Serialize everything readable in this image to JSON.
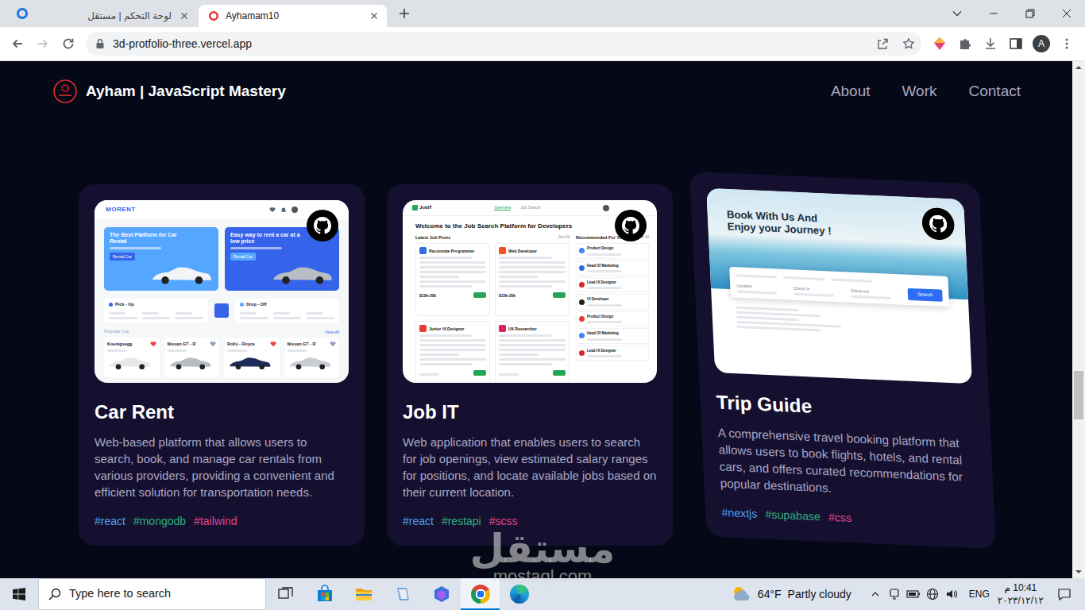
{
  "browser": {
    "tabs": [
      {
        "label": "لوحة التحكم | مستقل",
        "selected": false
      },
      {
        "label": "Ayhamam10",
        "selected": true
      }
    ],
    "back_enabled": true,
    "forward_enabled": false,
    "url": "3d-protfolio-three.vercel.app",
    "profile": "A"
  },
  "site": {
    "brand": "Ayham | JavaScript Mastery",
    "nav": [
      "About",
      "Work",
      "Contact"
    ]
  },
  "projects": [
    {
      "name": "Car Rent",
      "description": "Web-based platform that allows users to search, book, and manage car rentals from various providers, providing a convenient and efficient solution for transportation needs.",
      "tags": [
        {
          "label": "#react",
          "color": "#4a9fe8"
        },
        {
          "label": "#mongodb",
          "color": "#2fae7e"
        },
        {
          "label": "#tailwind",
          "color": "#e0448a"
        }
      ],
      "thumb": {
        "kind": "car",
        "brand": "MORENT",
        "hero": [
          {
            "title": "The Best Platform for Car Rental",
            "button": "Rental Car"
          },
          {
            "title": "Easy way to rent a car at a low price",
            "button": "Rental Car"
          }
        ],
        "pickup": [
          "Pick - Up",
          "Drop - Off"
        ],
        "section": "Popular Car",
        "link": "View All",
        "cars": [
          "Koenigsegg",
          "Nissan GT - R",
          "Rolls - Royce",
          "Nissan GT - R"
        ]
      }
    },
    {
      "name": "Job IT",
      "description": "Web application that enables users to search for job openings, view estimated salary ranges for positions, and locate available jobs based on their current location.",
      "tags": [
        {
          "label": "#react",
          "color": "#4a9fe8"
        },
        {
          "label": "#restapi",
          "color": "#2fae7e"
        },
        {
          "label": "#scss",
          "color": "#e0448a"
        }
      ],
      "thumb": {
        "kind": "job",
        "brand": "JobIT",
        "menu": [
          {
            "label": "Overview",
            "selected": true
          },
          {
            "label": "Job Search",
            "selected": false
          }
        ],
        "heading": "Welcome to the Job Search Platform for Developers",
        "latest": "Latest Job Posts",
        "latest_link": "See All",
        "jobs": [
          {
            "title": "Passionate Programmer",
            "salary": "$15k-20k"
          },
          {
            "title": "Web Developer",
            "salary": "$15k-20k"
          },
          {
            "title": "Junior UI Designer"
          },
          {
            "title": "UX Researcher"
          }
        ],
        "recommended": "Recommended For You",
        "rec_link": "See All",
        "recs": [
          "Product Design",
          "Head Of Marketing",
          "Lead UI Designer",
          "UI Developer",
          "Product Design",
          "Head Of Marketing",
          "Lead UI Designer"
        ]
      }
    },
    {
      "name": "Trip Guide",
      "description": "A comprehensive travel booking platform that allows users to book flights, hotels, and rental cars, and offers curated recommendations for popular destinations.",
      "tags": [
        {
          "label": "#nextjs",
          "color": "#4a9fe8"
        },
        {
          "label": "#supabase",
          "color": "#2fae7e"
        },
        {
          "label": "#css",
          "color": "#e0448a"
        }
      ],
      "thumb": {
        "kind": "trip",
        "heading": "Book With Us And Enjoy your Journey !",
        "fields": [
          "Location",
          "Check In",
          "Check out"
        ],
        "button": "Search"
      }
    }
  ],
  "scroll": {
    "level": 0.67
  },
  "taskbar": {
    "search": "Type here to search",
    "apps": [
      {
        "kind": "taskview",
        "selected": false
      },
      {
        "kind": "store",
        "selected": false
      },
      {
        "kind": "explorer",
        "selected": false
      },
      {
        "kind": "notes",
        "selected": false
      },
      {
        "kind": "copilot",
        "selected": false
      },
      {
        "kind": "chrome",
        "selected": true
      },
      {
        "kind": "edge",
        "selected": false
      }
    ],
    "weather": {
      "temp": "64°F",
      "text": "Partly cloudy"
    },
    "language": "ENG",
    "time": "10:41 م",
    "date": "٢٠٢٣/١٢/١٢"
  },
  "watermark": {
    "arabic": "مستقل",
    "latin": "mostaql.com"
  }
}
